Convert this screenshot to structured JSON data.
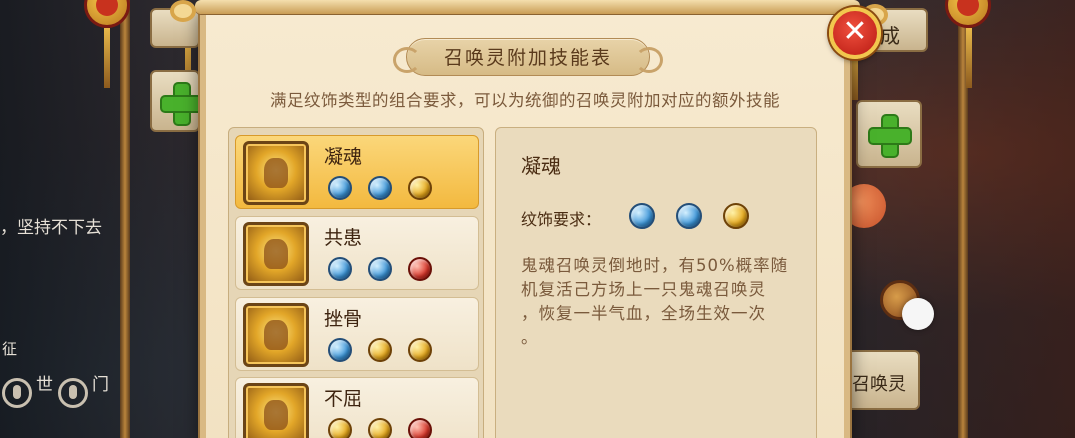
{
  "dialog": {
    "title": "召唤灵附加技能表",
    "subtitle": "满足纹饰类型的组合要求，可以为统御的召唤灵附加对应的额外技能",
    "close_label": "✕"
  },
  "skills": [
    {
      "name": "凝魂",
      "gems": [
        "blue",
        "blue",
        "gold"
      ],
      "selected": true
    },
    {
      "name": "共患",
      "gems": [
        "blue",
        "blue",
        "red"
      ],
      "selected": false
    },
    {
      "name": "挫骨",
      "gems": [
        "blue",
        "gold",
        "gold"
      ],
      "selected": false
    },
    {
      "name": "不屈",
      "gems": [
        "gold",
        "gold",
        "red"
      ],
      "selected": false
    }
  ],
  "detail": {
    "name": "凝魂",
    "requirement_label": "纹饰要求：",
    "gems": [
      "blue",
      "blue",
      "gold"
    ],
    "description": "鬼魂召唤灵倒地时，有50%概率随\n机复活己方场上一只鬼魂召唤灵\n，恢复一半气血，全场生效一次\n。"
  },
  "background": {
    "right_button_partial": "成",
    "left_text_partial": "，坚持不下去",
    "left_label_partial": "征",
    "left_bottom_text_1": "世",
    "left_bottom_text_2": "门",
    "right_bottom_button": "召唤灵"
  },
  "gem_colors": {
    "blue": "#3c95d8",
    "gold": "#e5a71c",
    "red": "#d8362a"
  }
}
